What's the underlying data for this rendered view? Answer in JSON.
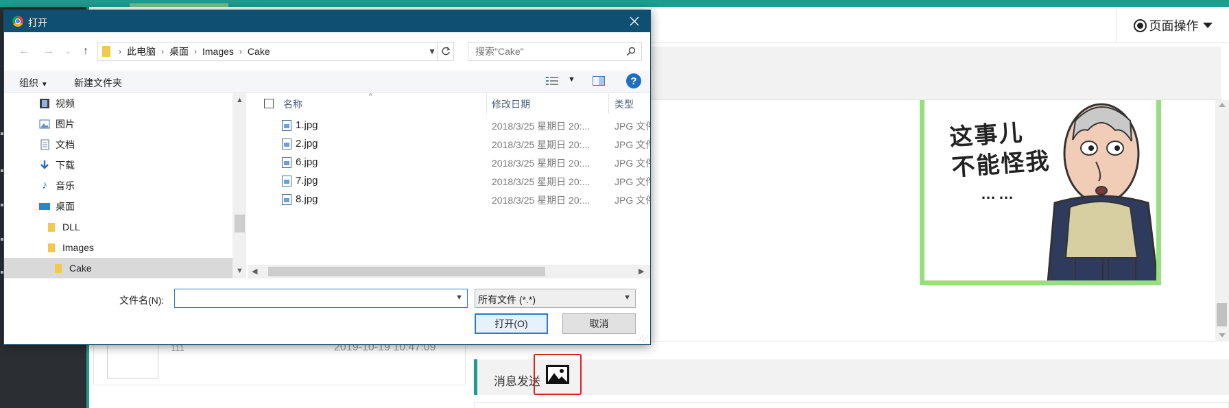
{
  "background_page": {
    "page_actions_label": "页面操作",
    "message_card": {
      "name": "111",
      "time": "2019-10-19 10:47:09"
    },
    "send_section_label": "消息发送",
    "meme_text_line1": "这事儿",
    "meme_text_line2": "不能怪我",
    "meme_text_dots": "……",
    "accent_color": "#1f9c8f"
  },
  "dialog": {
    "title": "打开",
    "breadcrumb": [
      "此电脑",
      "桌面",
      "Images",
      "Cake"
    ],
    "search_placeholder": "搜索\"Cake\"",
    "toolbar": {
      "organize": "组织",
      "new_folder": "新建文件夹"
    },
    "tree": [
      {
        "label": "视频",
        "icon": "video-icon"
      },
      {
        "label": "图片",
        "icon": "pictures-icon"
      },
      {
        "label": "文档",
        "icon": "documents-icon"
      },
      {
        "label": "下载",
        "icon": "download-icon"
      },
      {
        "label": "音乐",
        "icon": "music-icon"
      },
      {
        "label": "桌面",
        "icon": "desktop-icon"
      },
      {
        "label": "DLL",
        "icon": "folder-icon"
      },
      {
        "label": "Images",
        "icon": "folder-icon"
      },
      {
        "label": "Cake",
        "icon": "folder-icon",
        "selected": true
      }
    ],
    "columns": {
      "name": "名称",
      "modified": "修改日期",
      "type": "类型"
    },
    "files": [
      {
        "name": "1.jpg",
        "date": "2018/3/25 星期日 20:...",
        "type": "JPG 文件"
      },
      {
        "name": "2.jpg",
        "date": "2018/3/25 星期日 20:...",
        "type": "JPG 文件"
      },
      {
        "name": "6.jpg",
        "date": "2018/3/25 星期日 20:...",
        "type": "JPG 文件"
      },
      {
        "name": "7.jpg",
        "date": "2018/3/25 星期日 20:...",
        "type": "JPG 文件"
      },
      {
        "name": "8.jpg",
        "date": "2018/3/25 星期日 20:...",
        "type": "JPG 文件"
      }
    ],
    "filename_label": "文件名(N):",
    "filename_value": "",
    "filter_value": "所有文件 (*.*)",
    "open_label": "打开(O)",
    "cancel_label": "取消",
    "title_bar_color": "#0e4f72"
  }
}
